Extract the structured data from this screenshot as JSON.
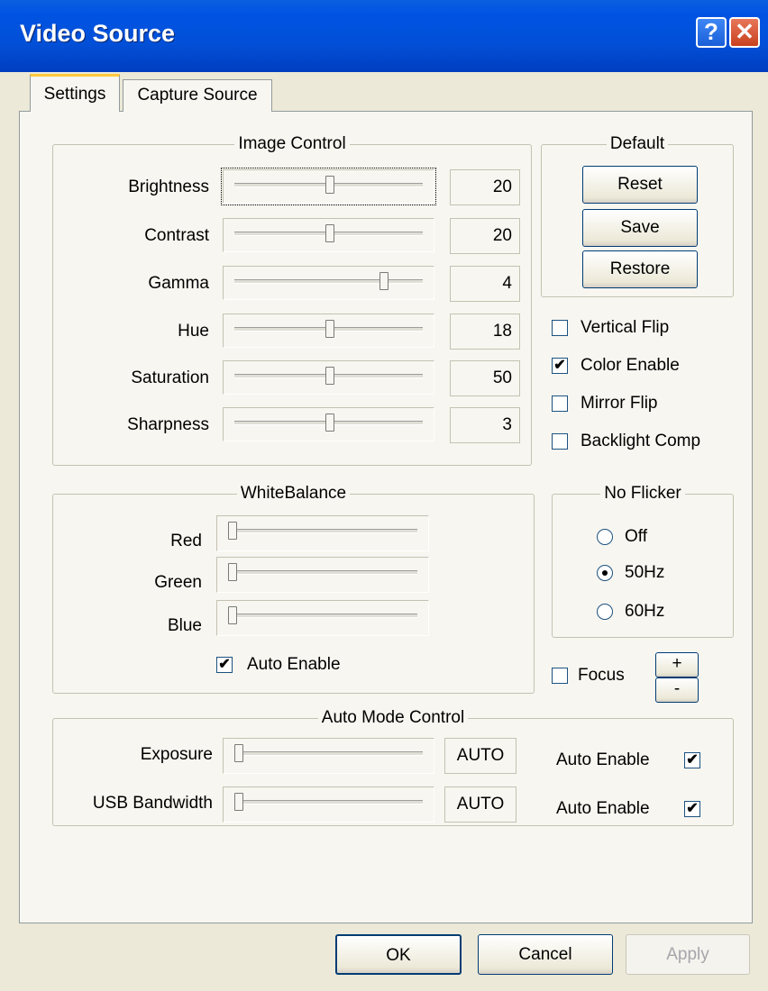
{
  "window": {
    "title": "Video Source",
    "help_label": "?",
    "close_label": "✕"
  },
  "tabs": [
    {
      "label": "Settings",
      "active": true
    },
    {
      "label": "Capture Source",
      "active": false
    }
  ],
  "image_control": {
    "title": "Image Control",
    "rows": [
      {
        "label": "Brightness",
        "value": "20",
        "level_pct": 50
      },
      {
        "label": "Contrast",
        "value": "20",
        "level_pct": 50
      },
      {
        "label": "Gamma",
        "value": "4",
        "level_pct": 80
      },
      {
        "label": "Hue",
        "value": "18",
        "level_pct": 50
      },
      {
        "label": "Saturation",
        "value": "50",
        "level_pct": 50
      },
      {
        "label": "Sharpness",
        "value": "3",
        "level_pct": 50
      }
    ]
  },
  "default_group": {
    "title": "Default",
    "reset": "Reset",
    "save": "Save",
    "restore": "Restore"
  },
  "flags": {
    "vertical_flip": {
      "label": "Vertical Flip",
      "checked": false
    },
    "color_enable": {
      "label": "Color Enable",
      "checked": true
    },
    "mirror_flip": {
      "label": "Mirror Flip",
      "checked": false
    },
    "backlight_comp": {
      "label": "Backlight Comp",
      "checked": false
    }
  },
  "white_balance": {
    "title": "WhiteBalance",
    "rows": [
      {
        "label": "Red",
        "level_pct": 0
      },
      {
        "label": "Green",
        "level_pct": 0
      },
      {
        "label": "Blue",
        "level_pct": 0
      }
    ],
    "auto_enable": {
      "label": "Auto Enable",
      "checked": true
    }
  },
  "no_flicker": {
    "title": "No Flicker",
    "options": [
      "Off",
      "50Hz",
      "60Hz"
    ],
    "selected": "50Hz"
  },
  "focus": {
    "label": "Focus",
    "checked": false,
    "plus": "+",
    "minus": "-"
  },
  "auto_mode": {
    "title": "Auto Mode Control",
    "rows": [
      {
        "label": "Exposure",
        "value": "AUTO",
        "auto_label": "Auto Enable",
        "auto_checked": true,
        "level_pct": 0
      },
      {
        "label": "USB Bandwidth",
        "value": "AUTO",
        "auto_label": "Auto Enable",
        "auto_checked": true,
        "level_pct": 0
      }
    ]
  },
  "footer": {
    "ok": "OK",
    "cancel": "Cancel",
    "apply": "Apply"
  },
  "colors": {
    "titlebar": "#0053e2",
    "face": "#ece9d8",
    "panel": "#f7f6f0",
    "disabled_text": "#a7a6aa"
  }
}
